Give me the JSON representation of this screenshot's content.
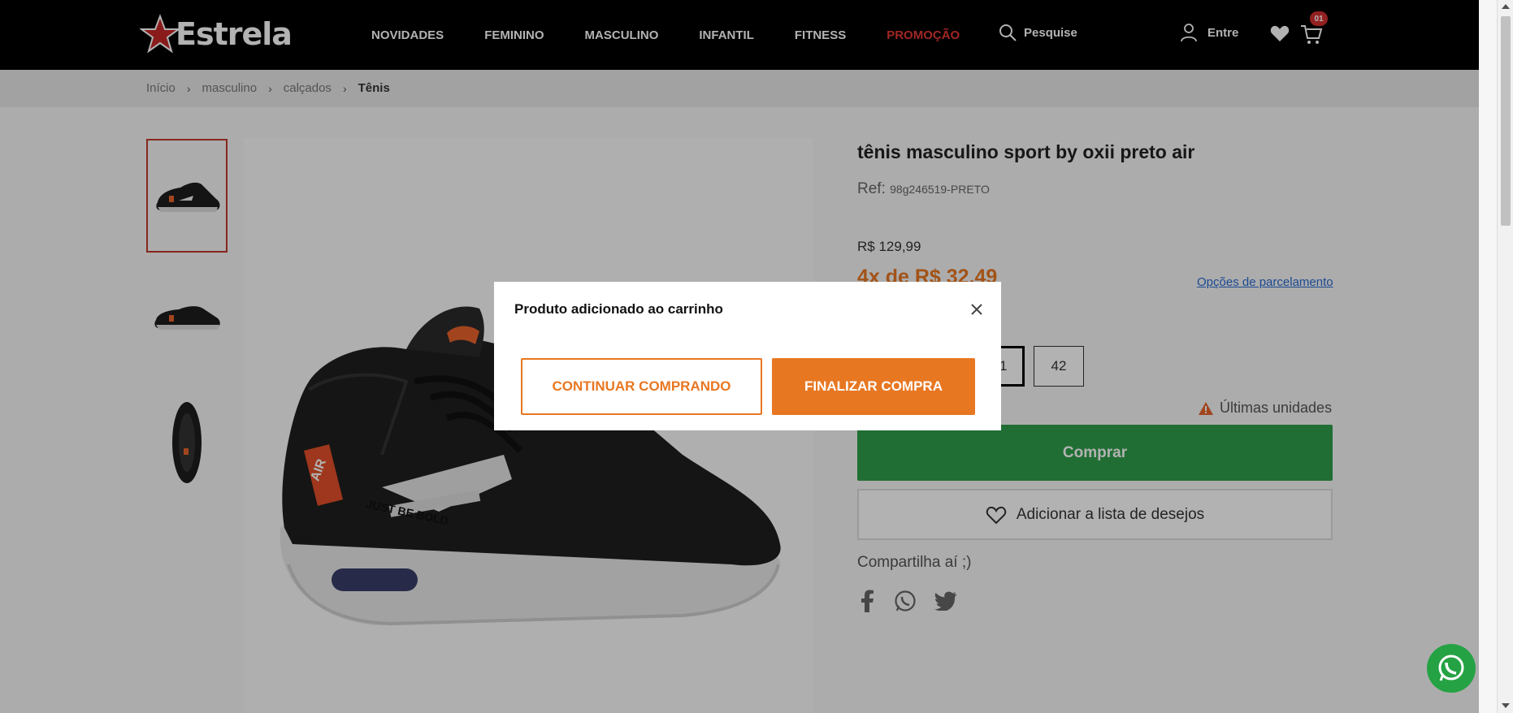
{
  "header": {
    "logo_text": "Estrela",
    "nav": [
      "NOVIDADES",
      "FEMININO",
      "MASCULINO",
      "INFANTIL",
      "FITNESS",
      "PROMOÇÃO"
    ],
    "promo_color": "#e53935",
    "search_label": "Pesquise",
    "login_label": "Entre",
    "cart_count": "01"
  },
  "breadcrumb": {
    "items": [
      "Início",
      "masculino",
      "calçados"
    ],
    "current": "Tênis"
  },
  "product": {
    "title": "tênis masculino sport by oxii preto air",
    "ref_label": "Ref:",
    "ref_code": "98g246519-PRETO",
    "price": "R$ 129,99",
    "installment": "4x de R$ 32,49",
    "installment_link": "Opções de parcelamento",
    "sizes": [
      "41",
      "42"
    ],
    "stock_notice": "Últimas unidades",
    "buy_label": "Comprar",
    "wishlist_label": "Adicionar a lista de desejos",
    "share_label": "Compartilha aí ;)",
    "shoe_print": [
      "AIR",
      "JUST BE BOLD"
    ]
  },
  "modal": {
    "title": "Produto adicionado ao carrinho",
    "continue_label": "CONTINUAR COMPRANDO",
    "finish_label": "FINALIZAR COMPRA"
  },
  "colors": {
    "accent": "#e87722",
    "buy": "#2e9e49",
    "thumb_active": "#c0392b"
  }
}
